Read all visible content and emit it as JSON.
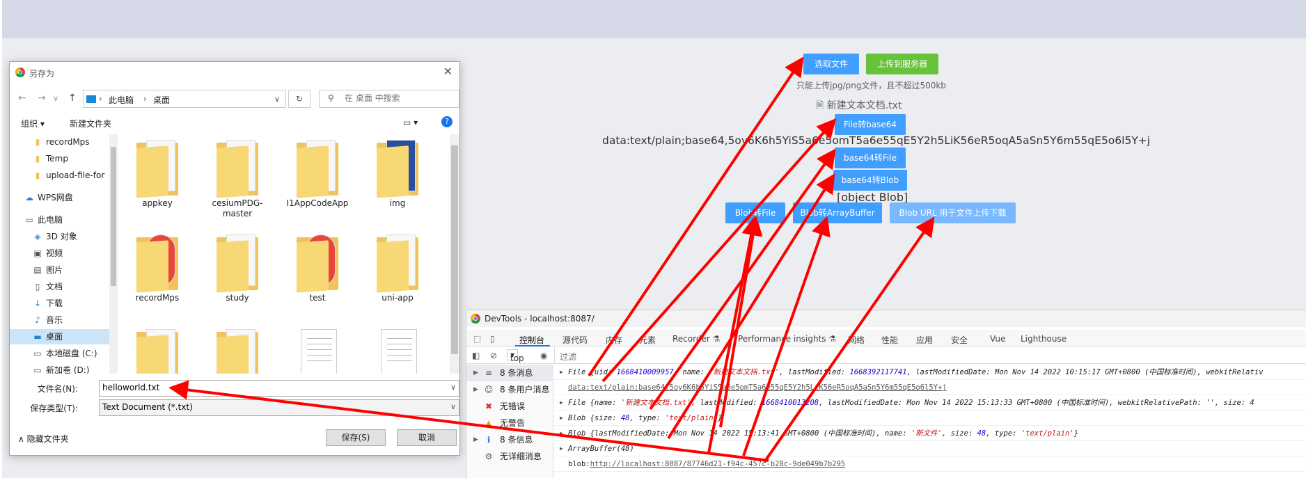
{
  "page": {
    "select_file_btn": "选取文件",
    "upload_btn": "上传到服务器",
    "hint": "只能上传jpg/png文件，且不超过500kb",
    "file_name": "新建文本文档.txt",
    "file_to_base64_btn": "File转base64",
    "base64_text": "data:text/plain;base64,5oy6K6h5YiS5a6e5omT5a6e55qE5Y2h5LiK56eR5oqA5aSn5Y6m55qE5o6l5Y+j",
    "base64_to_file_btn": "base64转File",
    "base64_to_blob_btn": "base64转Blob",
    "blob_text": "[object Blob]",
    "blob_to_file_btn": "Blob转File",
    "blob_to_arraybuffer_btn": "Blob转ArrayBuffer",
    "blob_url_btn": "Blob URL 用于文件上传下载"
  },
  "dialog": {
    "title": "另存为",
    "breadcrumb_pc": "此电脑",
    "breadcrumb_desktop": "桌面",
    "search_placeholder": "在 桌面 中搜索",
    "organize": "组织",
    "new_folder": "新建文件夹",
    "tree": [
      "recordMps",
      "Temp",
      "upload-file-for",
      "WPS网盘",
      "此电脑",
      "3D 对象",
      "视频",
      "图片",
      "文档",
      "下载",
      "音乐",
      "桌面",
      "本地磁盘 (C:)",
      "新加卷 (D:)"
    ],
    "files": [
      "appkey",
      "cesiumPDG-master",
      "I1AppCodeApp",
      "img",
      "recordMps",
      "study",
      "test",
      "uni-app",
      "",
      "",
      "",
      ""
    ],
    "filename_label": "文件名(N):",
    "filename_value": "helloworld.txt",
    "filetype_label": "保存类型(T):",
    "filetype_value": "Text Document (*.txt)",
    "hide_folders": "隐藏文件夹",
    "save": "保存(S)",
    "cancel": "取消"
  },
  "devtools": {
    "title": "DevTools - localhost:8087/",
    "tabs": [
      "控制台",
      "源代码",
      "内存",
      "元素",
      "Recorder",
      "Performance insights",
      "网络",
      "性能",
      "应用",
      "安全",
      "Vue",
      "Lighthouse"
    ],
    "context": "top",
    "filter_placeholder": "过滤",
    "side": [
      {
        "label": "8 条消息",
        "icon": "≡"
      },
      {
        "label": "8 条用户消息",
        "icon": "☺"
      },
      {
        "label": "无错误",
        "icon": "✖"
      },
      {
        "label": "无警告",
        "icon": "▲"
      },
      {
        "label": "8 条信息",
        "icon": "ℹ"
      },
      {
        "label": "无详细消息",
        "icon": "⚙"
      }
    ],
    "logs": {
      "l1_a": "File {uid: ",
      "l1_b": "1668410009957",
      "l1_c": ", name: ",
      "l1_d": "'新建文本文档.txt'",
      "l1_e": ", lastModified: ",
      "l1_f": "1668392117741",
      "l1_g": ", lastModifiedDate: Mon Nov 14 2022 10:15:17 GMT+0800 (中国标准时间), webkitRelativ",
      "l2": "data:text/plain;base64,5oy6K6h5YiS5a6e5omT5a6e55qE5Y2h5LiK56eR5oqA5aSn5Y6m55qE5o6l5Y+j",
      "l3_a": "File {name: ",
      "l3_b": "'新建文本文档.txt'",
      "l3_c": ", lastModified: ",
      "l3_d": "1668410013208",
      "l3_e": ", lastModifiedDate: Mon Nov 14 2022 15:13:33 GMT+0800 (中国标准时间), webkitRelativePath: '', size: 4",
      "l4_a": "Blob {size: ",
      "l4_b": "48",
      "l4_c": ", type: ",
      "l4_d": "'text/plain'",
      "l4_e": "}",
      "l5_a": "Blob {lastModifiedDate: Mon Nov 14 2022 15:13:41 GMT+0800 (中国标准时间), name: ",
      "l5_b": "'新文件'",
      "l5_c": ", size: ",
      "l5_d": "48",
      "l5_e": ", type: ",
      "l5_f": "'text/plain'",
      "l5_g": "}",
      "l6": "ArrayBuffer(48)",
      "l7_a": "blob:",
      "l7_b": "http://localhost:8087/87746d21-f94c-457c-b28c-9de049b7b295"
    }
  },
  "colors": {
    "primary": "#409eff",
    "success": "#67c23a",
    "arrow": "#ff0000"
  }
}
